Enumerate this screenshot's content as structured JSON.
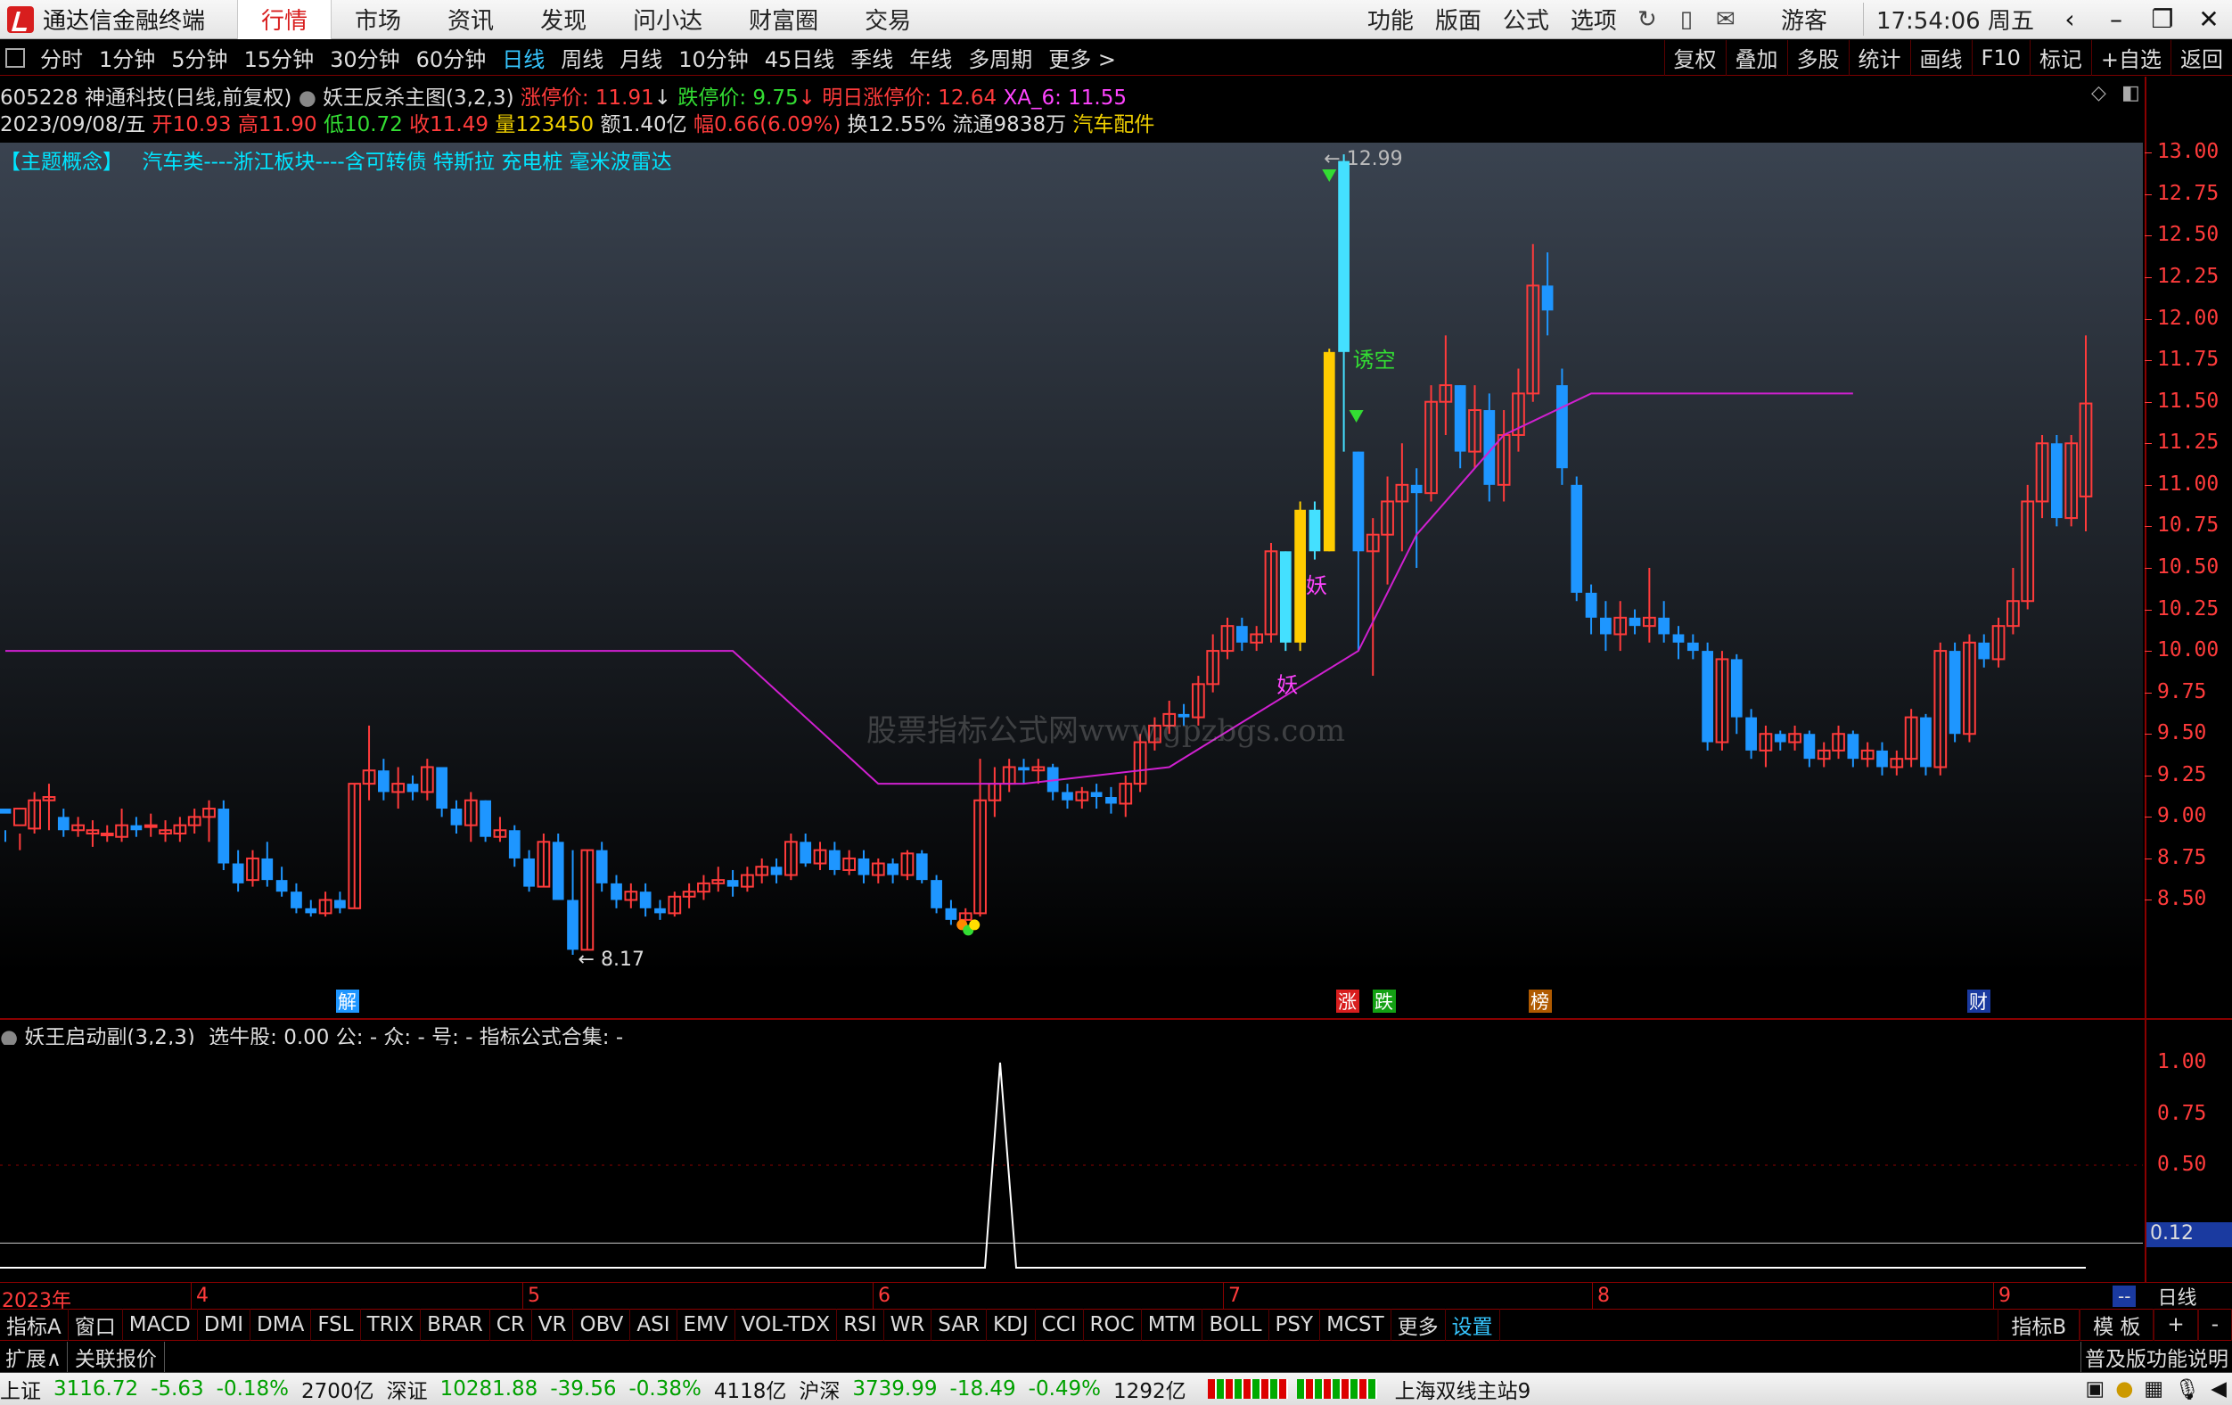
{
  "window": {
    "app_title": "通达信金融终端",
    "menus": [
      "行情",
      "市场",
      "资讯",
      "发现",
      "问小达",
      "财富圈",
      "交易"
    ],
    "active_menu": "行情",
    "right_menus": [
      "功能",
      "版面",
      "公式",
      "选项"
    ],
    "guest": "游客",
    "clock": "17:54:06 周五"
  },
  "periods": [
    "分时",
    "1分钟",
    "5分钟",
    "15分钟",
    "30分钟",
    "60分钟",
    "日线",
    "周线",
    "月线",
    "10分钟",
    "45日线",
    "季线",
    "年线",
    "多周期",
    "更多 >"
  ],
  "active_period": "日线",
  "tools": [
    "复权",
    "叠加",
    "多股",
    "统计",
    "画线",
    "F10",
    "标记",
    "+自选",
    "返回"
  ],
  "info1": {
    "title": "605228 神通科技(日线,前复权)",
    "formula": "妖王反杀主图(3,2,3)",
    "limit_up": "涨停价: 11.91",
    "limit_down": "跌停价: 9.75",
    "tomorrow": "明日涨停价: 12.64",
    "xa": "XA_6: 11.55"
  },
  "info2": {
    "date": "2023/09/08/五",
    "open": "开10.93",
    "high": "高11.90",
    "low": "低10.72",
    "close": "收11.49",
    "vol": "量123450",
    "amt": "额1.40亿",
    "chg": "幅0.66(6.09%)",
    "turn": "换12.55%",
    "float": "流通9838万",
    "sector": "汽车配件"
  },
  "concept": {
    "tag": "【主题概念】",
    "text": "汽车类----浙江板块----含可转债 特斯拉 充电桩 毫米波雷达"
  },
  "watermark": "股票指标公式网www.gpzbgs.com",
  "annotations": {
    "high": "12.99",
    "low": "8.17",
    "lure": "诱空",
    "yao1": "妖",
    "yao2": "妖"
  },
  "markers": [
    "解",
    "涨",
    "跌",
    "榜",
    "财"
  ],
  "price_ticks": [
    "13.00",
    "12.75",
    "12.50",
    "12.25",
    "12.00",
    "11.75",
    "11.50",
    "11.25",
    "11.00",
    "10.75",
    "10.50",
    "10.25",
    "10.00",
    "9.75",
    "9.50",
    "9.25",
    "9.00",
    "8.75",
    "8.50"
  ],
  "subchart": {
    "title": "妖王启动副(3,2,3)",
    "values": "选牛股: 0.00  公: -  众: -  号: -  指标公式合集: -",
    "ticks": [
      "1.00",
      "0.75",
      "0.50"
    ],
    "current": "0.12"
  },
  "time_axis": [
    "2023年",
    "4",
    "5",
    "6",
    "7",
    "8",
    "9"
  ],
  "time_axis_right": "日线",
  "indicators": [
    "指标A",
    "窗口",
    "MACD",
    "DMI",
    "DMA",
    "FSL",
    "TRIX",
    "BRAR",
    "CR",
    "VR",
    "OBV",
    "ASI",
    "EMV",
    "VOL-TDX",
    "RSI",
    "WR",
    "SAR",
    "KDJ",
    "CCI",
    "ROC",
    "MTM",
    "BOLL",
    "PSY",
    "MCST",
    "更多",
    "设置"
  ],
  "indicators_active": "设置",
  "indicator_right": [
    "指标B",
    "模 板",
    "+",
    "-"
  ],
  "ext": {
    "expand": "扩展∧",
    "quote": "关联报价",
    "right": "普及版功能说明"
  },
  "status": {
    "sh_label": "上证",
    "sh_val": "3116.72",
    "sh_chg": "-5.63",
    "sh_pct": "-0.18%",
    "sh_amt": "2700亿",
    "sz_label": "深证",
    "sz_val": "10281.88",
    "sz_chg": "-39.56",
    "sz_pct": "-0.38%",
    "sz_amt": "4118亿",
    "hs_label": "沪深",
    "hs_val": "3739.99",
    "hs_chg": "-18.49",
    "hs_pct": "-0.49%",
    "hs_amt": "1292亿",
    "server": "上海双线主站9"
  },
  "chart_data": {
    "type": "candlestick",
    "ylim": [
      8.1,
      13.05
    ],
    "candles": [
      [
        9.05,
        9.02,
        8.92,
        8.85
      ],
      [
        8.95,
        9.05,
        8.9,
        8.8
      ],
      [
        8.93,
        9.1,
        9.15,
        8.9
      ],
      [
        9.1,
        9.12,
        9.2,
        8.92
      ],
      [
        9.0,
        8.92,
        9.05,
        8.88
      ],
      [
        8.92,
        8.95,
        9.0,
        8.88
      ],
      [
        8.9,
        8.92,
        8.98,
        8.82
      ],
      [
        8.9,
        8.9,
        8.95,
        8.85
      ],
      [
        8.88,
        8.95,
        9.05,
        8.85
      ],
      [
        8.95,
        8.92,
        9.0,
        8.88
      ],
      [
        8.95,
        8.95,
        9.02,
        8.88
      ],
      [
        8.9,
        8.92,
        8.98,
        8.85
      ],
      [
        8.9,
        8.95,
        9.0,
        8.85
      ],
      [
        8.95,
        9.0,
        9.05,
        8.9
      ],
      [
        9.0,
        9.05,
        9.1,
        8.85
      ],
      [
        9.05,
        8.72,
        9.1,
        8.68
      ],
      [
        8.72,
        8.6,
        8.8,
        8.55
      ],
      [
        8.62,
        8.75,
        8.8,
        8.58
      ],
      [
        8.75,
        8.62,
        8.85,
        8.58
      ],
      [
        8.62,
        8.55,
        8.7,
        8.52
      ],
      [
        8.55,
        8.45,
        8.6,
        8.42
      ],
      [
        8.45,
        8.42,
        8.5,
        8.4
      ],
      [
        8.42,
        8.5,
        8.55,
        8.4
      ],
      [
        8.5,
        8.45,
        8.55,
        8.42
      ],
      [
        8.45,
        9.2,
        9.2,
        8.45
      ],
      [
        9.2,
        9.28,
        9.55,
        9.1
      ],
      [
        9.28,
        9.15,
        9.35,
        9.1
      ],
      [
        9.15,
        9.2,
        9.3,
        9.05
      ],
      [
        9.2,
        9.15,
        9.25,
        9.1
      ],
      [
        9.15,
        9.3,
        9.35,
        9.1
      ],
      [
        9.3,
        9.05,
        9.3,
        9.0
      ],
      [
        9.05,
        8.95,
        9.1,
        8.9
      ],
      [
        8.95,
        9.1,
        9.15,
        8.85
      ],
      [
        9.1,
        8.88,
        9.1,
        8.85
      ],
      [
        8.88,
        8.92,
        9.0,
        8.85
      ],
      [
        8.92,
        8.75,
        8.95,
        8.7
      ],
      [
        8.75,
        8.58,
        8.8,
        8.55
      ],
      [
        8.58,
        8.85,
        8.9,
        8.58
      ],
      [
        8.85,
        8.5,
        8.9,
        8.5
      ],
      [
        8.5,
        8.2,
        8.8,
        8.17
      ],
      [
        8.2,
        8.8,
        8.8,
        8.2
      ],
      [
        8.8,
        8.6,
        8.85,
        8.55
      ],
      [
        8.6,
        8.5,
        8.65,
        8.45
      ],
      [
        8.5,
        8.55,
        8.6,
        8.45
      ],
      [
        8.55,
        8.45,
        8.6,
        8.4
      ],
      [
        8.45,
        8.42,
        8.5,
        8.38
      ],
      [
        8.42,
        8.52,
        8.55,
        8.4
      ],
      [
        8.52,
        8.55,
        8.6,
        8.45
      ],
      [
        8.55,
        8.6,
        8.65,
        8.5
      ],
      [
        8.6,
        8.62,
        8.7,
        8.55
      ],
      [
        8.62,
        8.58,
        8.68,
        8.52
      ],
      [
        8.58,
        8.65,
        8.7,
        8.55
      ],
      [
        8.65,
        8.7,
        8.75,
        8.6
      ],
      [
        8.7,
        8.65,
        8.75,
        8.6
      ],
      [
        8.65,
        8.85,
        8.9,
        8.62
      ],
      [
        8.85,
        8.72,
        8.9,
        8.7
      ],
      [
        8.72,
        8.8,
        8.85,
        8.68
      ],
      [
        8.8,
        8.68,
        8.85,
        8.65
      ],
      [
        8.68,
        8.75,
        8.8,
        8.65
      ],
      [
        8.75,
        8.65,
        8.8,
        8.6
      ],
      [
        8.65,
        8.72,
        8.75,
        8.6
      ],
      [
        8.72,
        8.65,
        8.75,
        8.6
      ],
      [
        8.65,
        8.78,
        8.8,
        8.62
      ],
      [
        8.78,
        8.62,
        8.8,
        8.6
      ],
      [
        8.62,
        8.45,
        8.65,
        8.42
      ],
      [
        8.45,
        8.38,
        8.5,
        8.35
      ],
      [
        8.38,
        8.42,
        8.45,
        8.35
      ],
      [
        8.42,
        9.1,
        9.35,
        8.4
      ],
      [
        9.1,
        9.2,
        9.3,
        9.0
      ],
      [
        9.2,
        9.3,
        9.35,
        9.15
      ],
      [
        9.3,
        9.28,
        9.35,
        9.2
      ],
      [
        9.28,
        9.3,
        9.35,
        9.2
      ],
      [
        9.3,
        9.15,
        9.32,
        9.1
      ],
      [
        9.15,
        9.1,
        9.2,
        9.05
      ],
      [
        9.1,
        9.15,
        9.18,
        9.05
      ],
      [
        9.15,
        9.12,
        9.2,
        9.05
      ],
      [
        9.12,
        9.08,
        9.18,
        9.02
      ],
      [
        9.08,
        9.2,
        9.25,
        9.0
      ],
      [
        9.2,
        9.45,
        9.5,
        9.15
      ],
      [
        9.45,
        9.55,
        9.6,
        9.4
      ],
      [
        9.55,
        9.62,
        9.7,
        9.5
      ],
      [
        9.62,
        9.6,
        9.68,
        9.55
      ],
      [
        9.6,
        9.8,
        9.85,
        9.55
      ],
      [
        9.8,
        10.0,
        10.1,
        9.75
      ],
      [
        10.0,
        10.15,
        10.2,
        9.95
      ],
      [
        10.15,
        10.05,
        10.2,
        10.0
      ],
      [
        10.05,
        10.1,
        10.15,
        10.0
      ],
      [
        10.1,
        10.6,
        10.65,
        10.05
      ],
      [
        10.6,
        10.05,
        10.6,
        10.0
      ],
      [
        10.05,
        10.85,
        10.9,
        10.0
      ],
      [
        10.85,
        10.6,
        10.9,
        10.55
      ],
      [
        10.6,
        11.8,
        11.82,
        10.6
      ],
      [
        11.8,
        12.95,
        12.99,
        11.2
      ],
      [
        11.2,
        10.6,
        11.2,
        10.0
      ],
      [
        10.6,
        10.7,
        10.8,
        9.85
      ],
      [
        10.7,
        10.9,
        11.05,
        10.4
      ],
      [
        10.9,
        11.0,
        11.25,
        10.6
      ],
      [
        11.0,
        10.95,
        11.1,
        10.5
      ],
      [
        10.95,
        11.5,
        11.6,
        10.9
      ],
      [
        11.5,
        11.6,
        11.9,
        11.3
      ],
      [
        11.6,
        11.2,
        11.6,
        11.1
      ],
      [
        11.2,
        11.45,
        11.6,
        11.1
      ],
      [
        11.45,
        11.0,
        11.55,
        10.9
      ],
      [
        11.0,
        11.3,
        11.45,
        10.9
      ],
      [
        11.3,
        11.55,
        11.7,
        11.2
      ],
      [
        11.55,
        12.2,
        12.45,
        11.5
      ],
      [
        12.2,
        12.05,
        12.4,
        11.9
      ],
      [
        11.6,
        11.1,
        11.7,
        11.0
      ],
      [
        11.0,
        10.35,
        11.05,
        10.3
      ],
      [
        10.35,
        10.2,
        10.4,
        10.1
      ],
      [
        10.2,
        10.1,
        10.3,
        10.0
      ],
      [
        10.1,
        10.2,
        10.3,
        10.0
      ],
      [
        10.2,
        10.15,
        10.25,
        10.1
      ],
      [
        10.15,
        10.2,
        10.5,
        10.05
      ],
      [
        10.2,
        10.1,
        10.3,
        10.05
      ],
      [
        10.1,
        10.05,
        10.15,
        9.95
      ],
      [
        10.05,
        10.0,
        10.1,
        9.95
      ],
      [
        10.0,
        9.45,
        10.05,
        9.4
      ],
      [
        9.45,
        9.95,
        10.0,
        9.4
      ],
      [
        9.95,
        9.6,
        9.98,
        9.5
      ],
      [
        9.6,
        9.4,
        9.65,
        9.35
      ],
      [
        9.4,
        9.5,
        9.55,
        9.3
      ],
      [
        9.5,
        9.45,
        9.52,
        9.4
      ],
      [
        9.45,
        9.5,
        9.55,
        9.4
      ],
      [
        9.5,
        9.35,
        9.52,
        9.3
      ],
      [
        9.35,
        9.4,
        9.45,
        9.3
      ],
      [
        9.4,
        9.5,
        9.55,
        9.35
      ],
      [
        9.5,
        9.35,
        9.52,
        9.3
      ],
      [
        9.35,
        9.4,
        9.45,
        9.3
      ],
      [
        9.4,
        9.3,
        9.45,
        9.25
      ],
      [
        9.3,
        9.35,
        9.4,
        9.25
      ],
      [
        9.35,
        9.6,
        9.65,
        9.3
      ],
      [
        9.6,
        9.3,
        9.62,
        9.25
      ],
      [
        9.3,
        10.0,
        10.05,
        9.25
      ],
      [
        10.0,
        9.5,
        10.05,
        9.45
      ],
      [
        9.5,
        10.05,
        10.1,
        9.45
      ],
      [
        10.05,
        9.95,
        10.1,
        9.9
      ],
      [
        9.95,
        10.15,
        10.2,
        9.9
      ],
      [
        10.15,
        10.3,
        10.5,
        10.1
      ],
      [
        10.3,
        10.9,
        11.0,
        10.25
      ],
      [
        10.9,
        11.25,
        11.3,
        10.8
      ],
      [
        11.25,
        10.8,
        11.3,
        10.75
      ],
      [
        10.8,
        11.25,
        11.3,
        10.75
      ],
      [
        10.93,
        11.49,
        11.9,
        10.72
      ]
    ],
    "ma": [
      [
        0,
        10.0
      ],
      [
        50,
        10.0
      ],
      [
        60,
        9.2
      ],
      [
        70,
        9.2
      ],
      [
        80,
        9.3
      ],
      [
        93,
        10.0
      ],
      [
        97,
        10.7
      ],
      [
        103,
        11.3
      ],
      [
        109,
        11.55
      ],
      [
        118,
        11.55
      ],
      [
        127,
        11.55
      ]
    ]
  }
}
